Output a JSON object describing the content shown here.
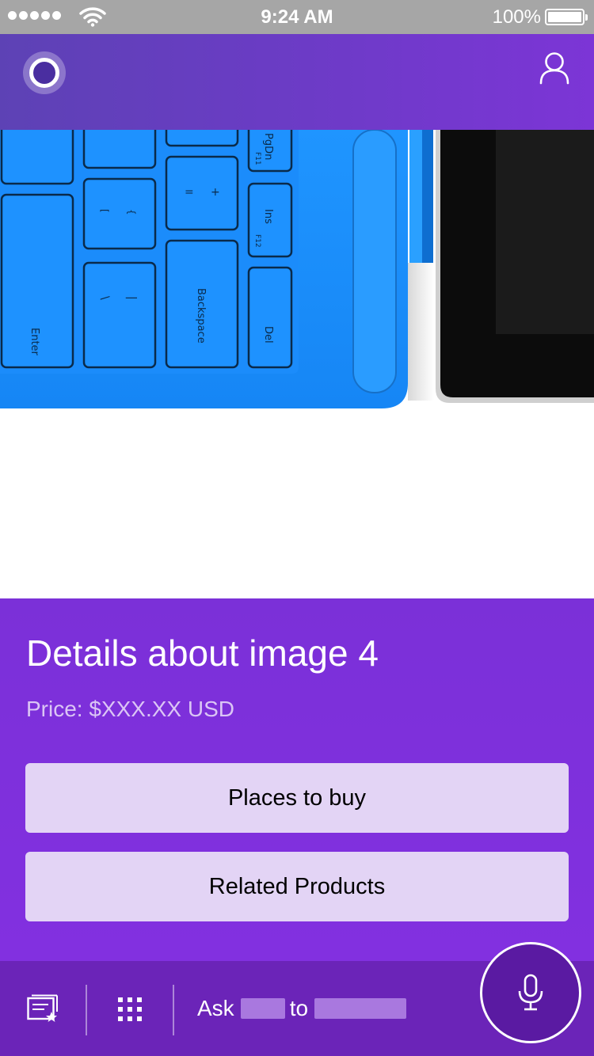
{
  "status_bar": {
    "time": "9:24 AM",
    "battery_percent": "100%",
    "signal_bars": 5,
    "icons": [
      "signal-dots-icon",
      "wifi-icon",
      "battery-icon"
    ]
  },
  "header": {
    "logo_icon": "cortana-ring-icon",
    "profile_icon": "person-icon"
  },
  "product_image": {
    "subject": "blue keyboard cover attached to tablet",
    "key_labels": [
      "Enter",
      "Backspace",
      "Del",
      "Ins",
      "F12",
      "F11",
      "PgDn",
      "=",
      "+",
      "[",
      "{",
      "]",
      "}",
      "\\",
      "|",
      "'",
      "\""
    ]
  },
  "details": {
    "title": "Details about image 4",
    "price": "Price: $XXX.XX USD",
    "buttons": [
      {
        "label": "Places to buy"
      },
      {
        "label": "Related Products"
      }
    ]
  },
  "bottom_bar": {
    "notebook_icon": "notebook-star-icon",
    "apps_icon": "grid-dots-icon",
    "ask_word": "Ask",
    "to_word": "to",
    "mic_icon": "microphone-icon"
  },
  "colors": {
    "status_bar": "#a6a6a6",
    "header_start": "#5d42b5",
    "header_end": "#7c35d6",
    "panel": "#7e30dc",
    "button_bg": "#e3d4f5",
    "bottom_bar": "#6b24b8",
    "mic_bg": "#5a1aa2",
    "keyboard_blue": "#1a8fff"
  }
}
